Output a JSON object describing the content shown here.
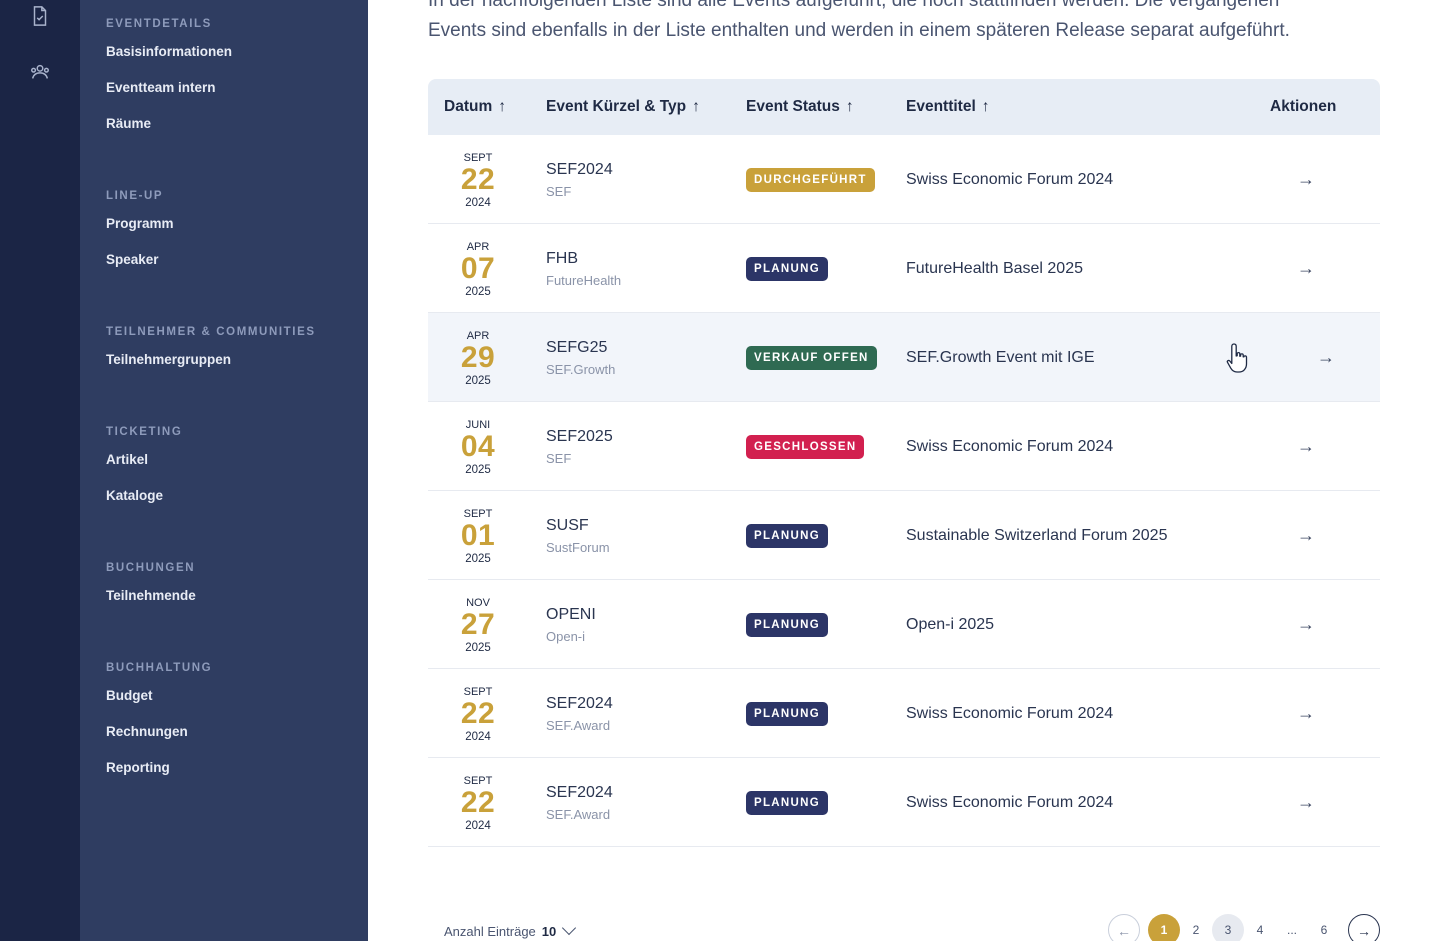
{
  "intro": {
    "line1": "In der nachfolgenden Liste sind alle Events aufgeführt, die noch stattfinden werden. Die vergangenen",
    "line2": "Events sind ebenfalls in der Liste enthalten und werden in einem späteren Release separat aufgeführt."
  },
  "sidebar": {
    "sections": [
      {
        "title": "Eventdetails",
        "items": [
          "Basisinformationen",
          "Eventteam intern",
          "Räume"
        ]
      },
      {
        "title": "Line-Up",
        "items": [
          "Programm",
          "Speaker"
        ]
      },
      {
        "title": "Teilnehmer & Communities",
        "items": [
          "Teilnehmergruppen"
        ]
      },
      {
        "title": "Ticketing",
        "items": [
          "Artikel",
          "Kataloge"
        ]
      },
      {
        "title": "Buchungen",
        "items": [
          "Teilnehmende"
        ]
      },
      {
        "title": "Buchhaltung",
        "items": [
          "Budget",
          "Rechnungen",
          "Reporting"
        ]
      }
    ]
  },
  "rail": {
    "icons": [
      "document-icon",
      "team-icon"
    ]
  },
  "table": {
    "headers": {
      "datum": "Datum",
      "kuerzel": "Event Kürzel & Typ",
      "status": "Event Status",
      "titel": "Eventtitel",
      "aktionen": "Aktionen"
    },
    "sort_arrow": "↑",
    "action_arrow": "→",
    "rows": [
      {
        "month": "SEPT",
        "day": "22",
        "year": "2024",
        "code": "SEF2024",
        "type": "SEF",
        "status": "DURCHGEFÜHRT",
        "status_color": "#c9a13a",
        "title": "Swiss Economic Forum 2024"
      },
      {
        "month": "APR",
        "day": "07",
        "year": "2025",
        "code": "FHB",
        "type": "FutureHealth",
        "status": "PLANUNG",
        "status_color": "#2c3567",
        "title": "FutureHealth Basel 2025"
      },
      {
        "month": "APR",
        "day": "29",
        "year": "2025",
        "code": "SEFG25",
        "type": "SEF.Growth",
        "status": "VERKAUF OFFEN",
        "status_color": "#2f6a52",
        "title": "SEF.Growth Event mit IGE"
      },
      {
        "month": "JUNI",
        "day": "04",
        "year": "2025",
        "code": "SEF2025",
        "type": "SEF",
        "status": "GESCHLOSSEN",
        "status_color": "#d2204f",
        "title": "Swiss Economic Forum 2024"
      },
      {
        "month": "SEPT",
        "day": "01",
        "year": "2025",
        "code": "SUSF",
        "type": "SustForum",
        "status": "PLANUNG",
        "status_color": "#2c3567",
        "title": "Sustainable Switzerland Forum 2025"
      },
      {
        "month": "NOV",
        "day": "27",
        "year": "2025",
        "code": "OPENI",
        "type": "Open-i",
        "status": "PLANUNG",
        "status_color": "#2c3567",
        "title": "Open-i 2025"
      },
      {
        "month": "SEPT",
        "day": "22",
        "year": "2024",
        "code": "SEF2024",
        "type": "SEF.Award",
        "status": "PLANUNG",
        "status_color": "#2c3567",
        "title": "Swiss Economic Forum 2024"
      },
      {
        "month": "SEPT",
        "day": "22",
        "year": "2024",
        "code": "SEF2024",
        "type": "SEF.Award",
        "status": "PLANUNG",
        "status_color": "#2c3567",
        "title": "Swiss Economic Forum 2024"
      }
    ]
  },
  "footer": {
    "count_label": "Anzahl Einträge",
    "count_value": "10",
    "pages": [
      "1",
      "2",
      "3",
      "4",
      "...",
      "6"
    ],
    "prev": "←",
    "next": "→"
  },
  "colors": {
    "gold": "#c9a13a",
    "navy": "#2f3d61",
    "rail": "#1b2545"
  }
}
